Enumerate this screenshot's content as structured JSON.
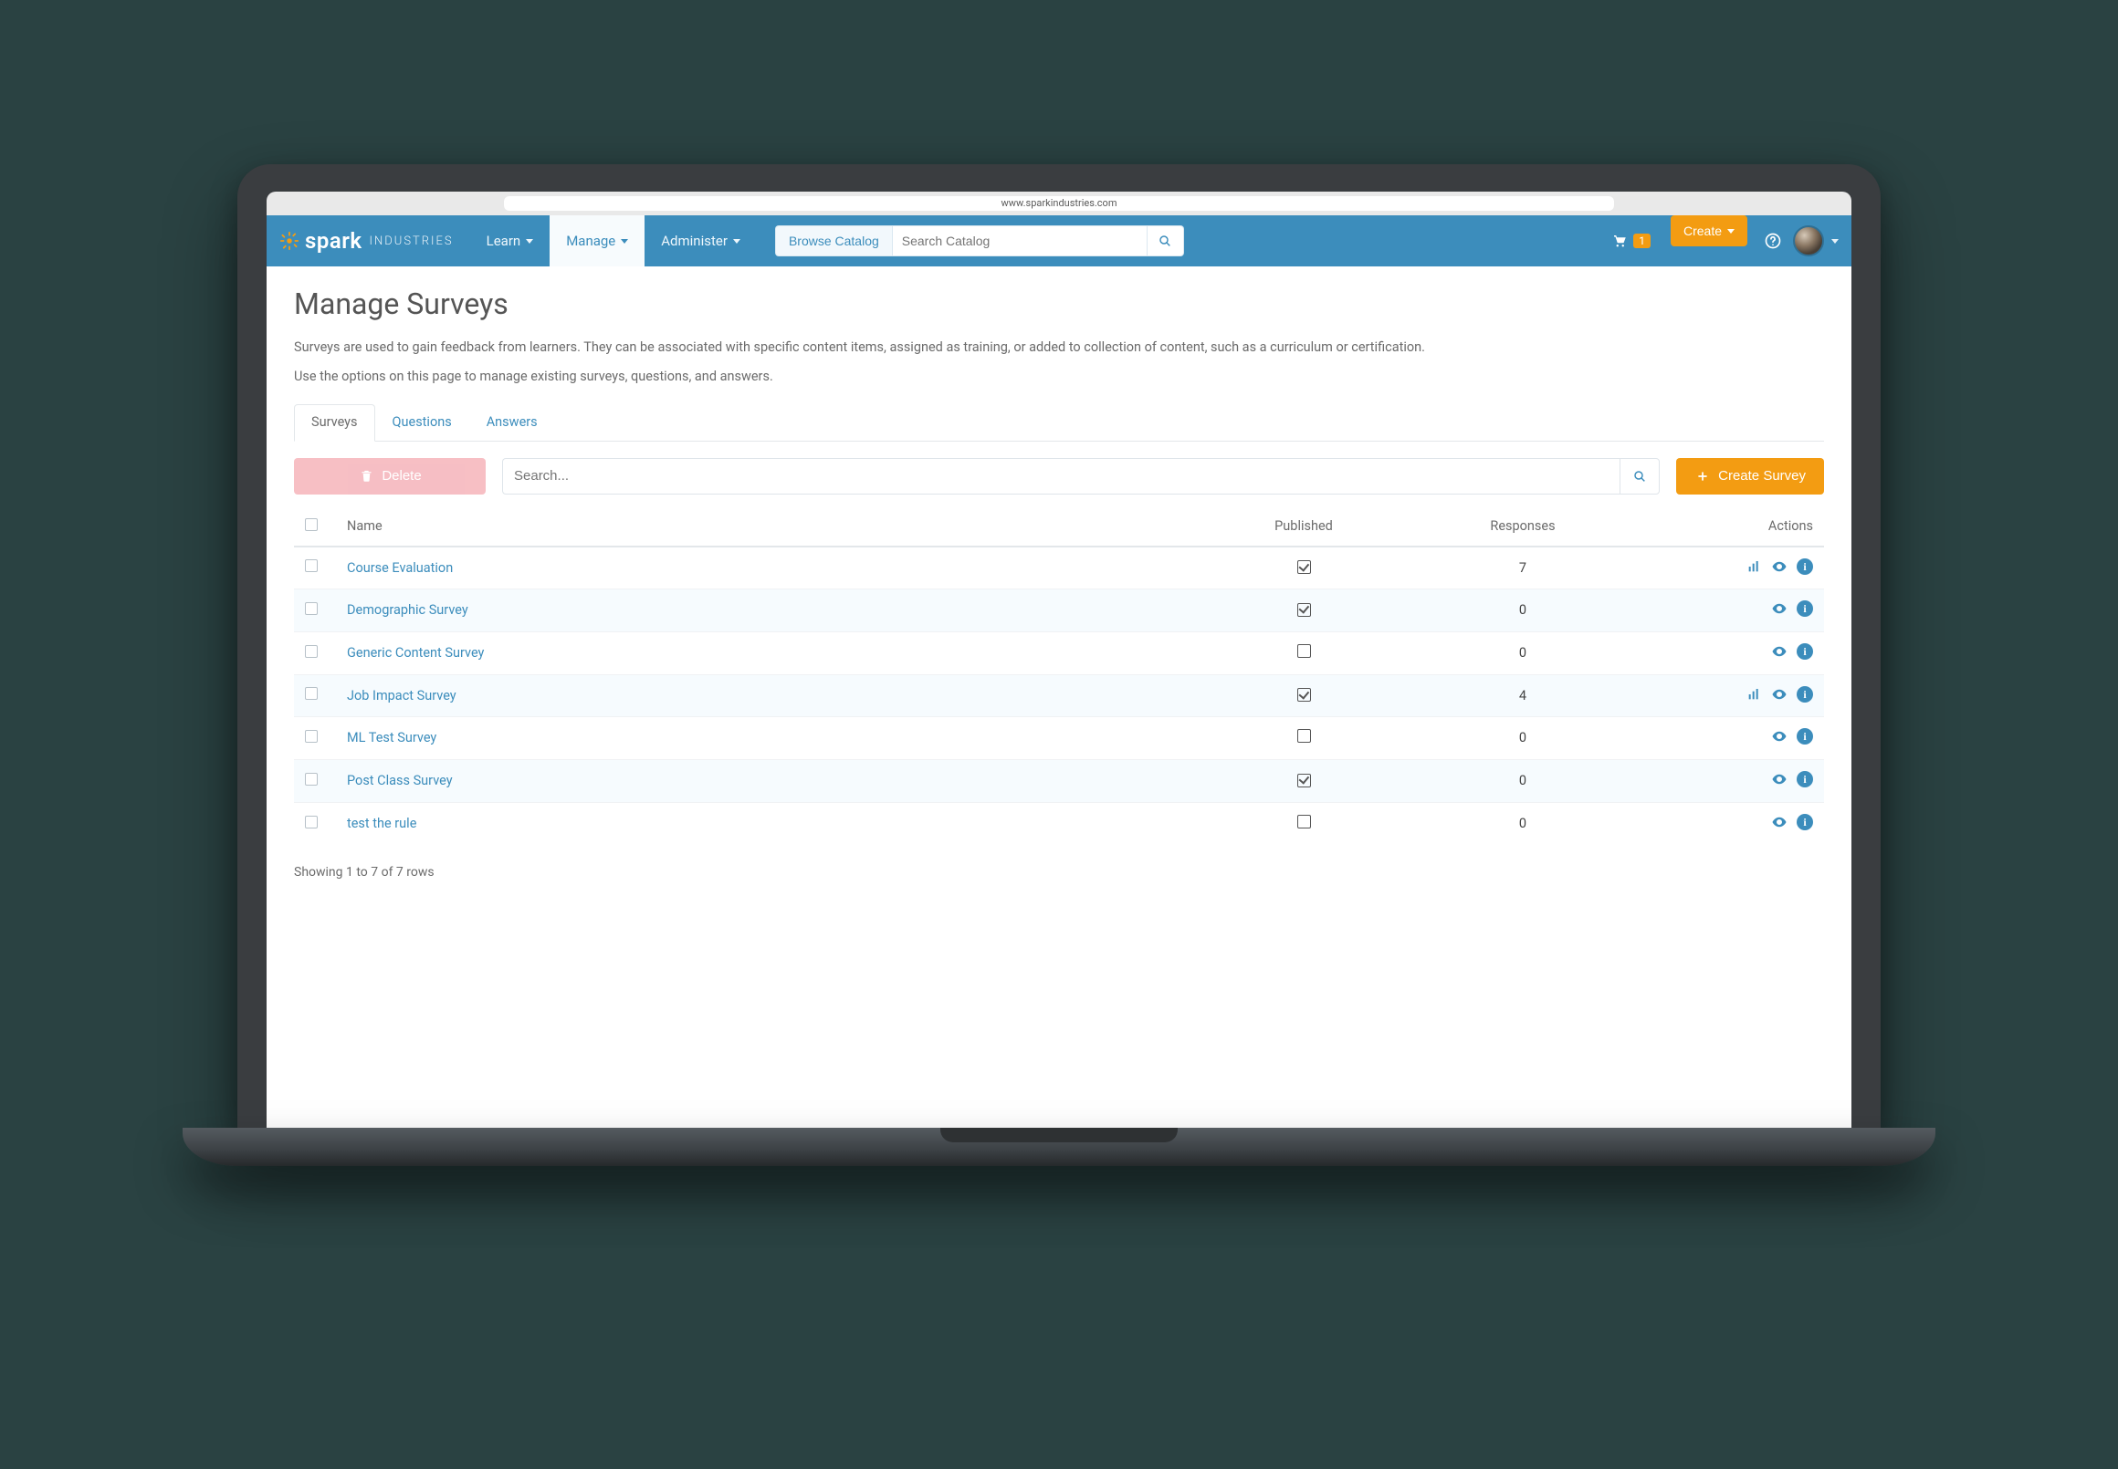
{
  "browser": {
    "address": "www.sparkindustries.com"
  },
  "brand": {
    "main": "spark",
    "sub": "INDUSTRIES"
  },
  "nav": {
    "learn": "Learn",
    "manage": "Manage",
    "administer": "Administer",
    "browse_catalog": "Browse Catalog",
    "search_placeholder": "Search Catalog",
    "create": "Create",
    "cart_count": "1"
  },
  "page": {
    "title": "Manage Surveys",
    "desc1": "Surveys are used to gain feedback from learners. They can be associated with specific content items, assigned as training, or added to collection of content, such as a curriculum or certification.",
    "desc2": "Use the options on this page to manage existing surveys, questions, and answers."
  },
  "tabs": {
    "surveys": "Surveys",
    "questions": "Questions",
    "answers": "Answers"
  },
  "toolbar": {
    "delete_label": "Delete",
    "search_placeholder": "Search...",
    "create_survey": "Create Survey"
  },
  "table": {
    "headers": {
      "name": "Name",
      "published": "Published",
      "responses": "Responses",
      "actions": "Actions"
    },
    "rows": [
      {
        "name": "Course Evaluation",
        "published": true,
        "responses": "7",
        "has_chart": true
      },
      {
        "name": "Demographic Survey",
        "published": true,
        "responses": "0",
        "has_chart": false
      },
      {
        "name": "Generic Content Survey",
        "published": false,
        "responses": "0",
        "has_chart": false
      },
      {
        "name": "Job Impact Survey",
        "published": true,
        "responses": "4",
        "has_chart": true
      },
      {
        "name": "ML Test Survey",
        "published": false,
        "responses": "0",
        "has_chart": false
      },
      {
        "name": "Post Class Survey",
        "published": true,
        "responses": "0",
        "has_chart": false
      },
      {
        "name": "test the rule",
        "published": false,
        "responses": "0",
        "has_chart": false
      }
    ],
    "footer": "Showing 1 to 7 of 7 rows"
  },
  "colors": {
    "primary": "#3c8dbc",
    "accent": "#f39c12"
  }
}
